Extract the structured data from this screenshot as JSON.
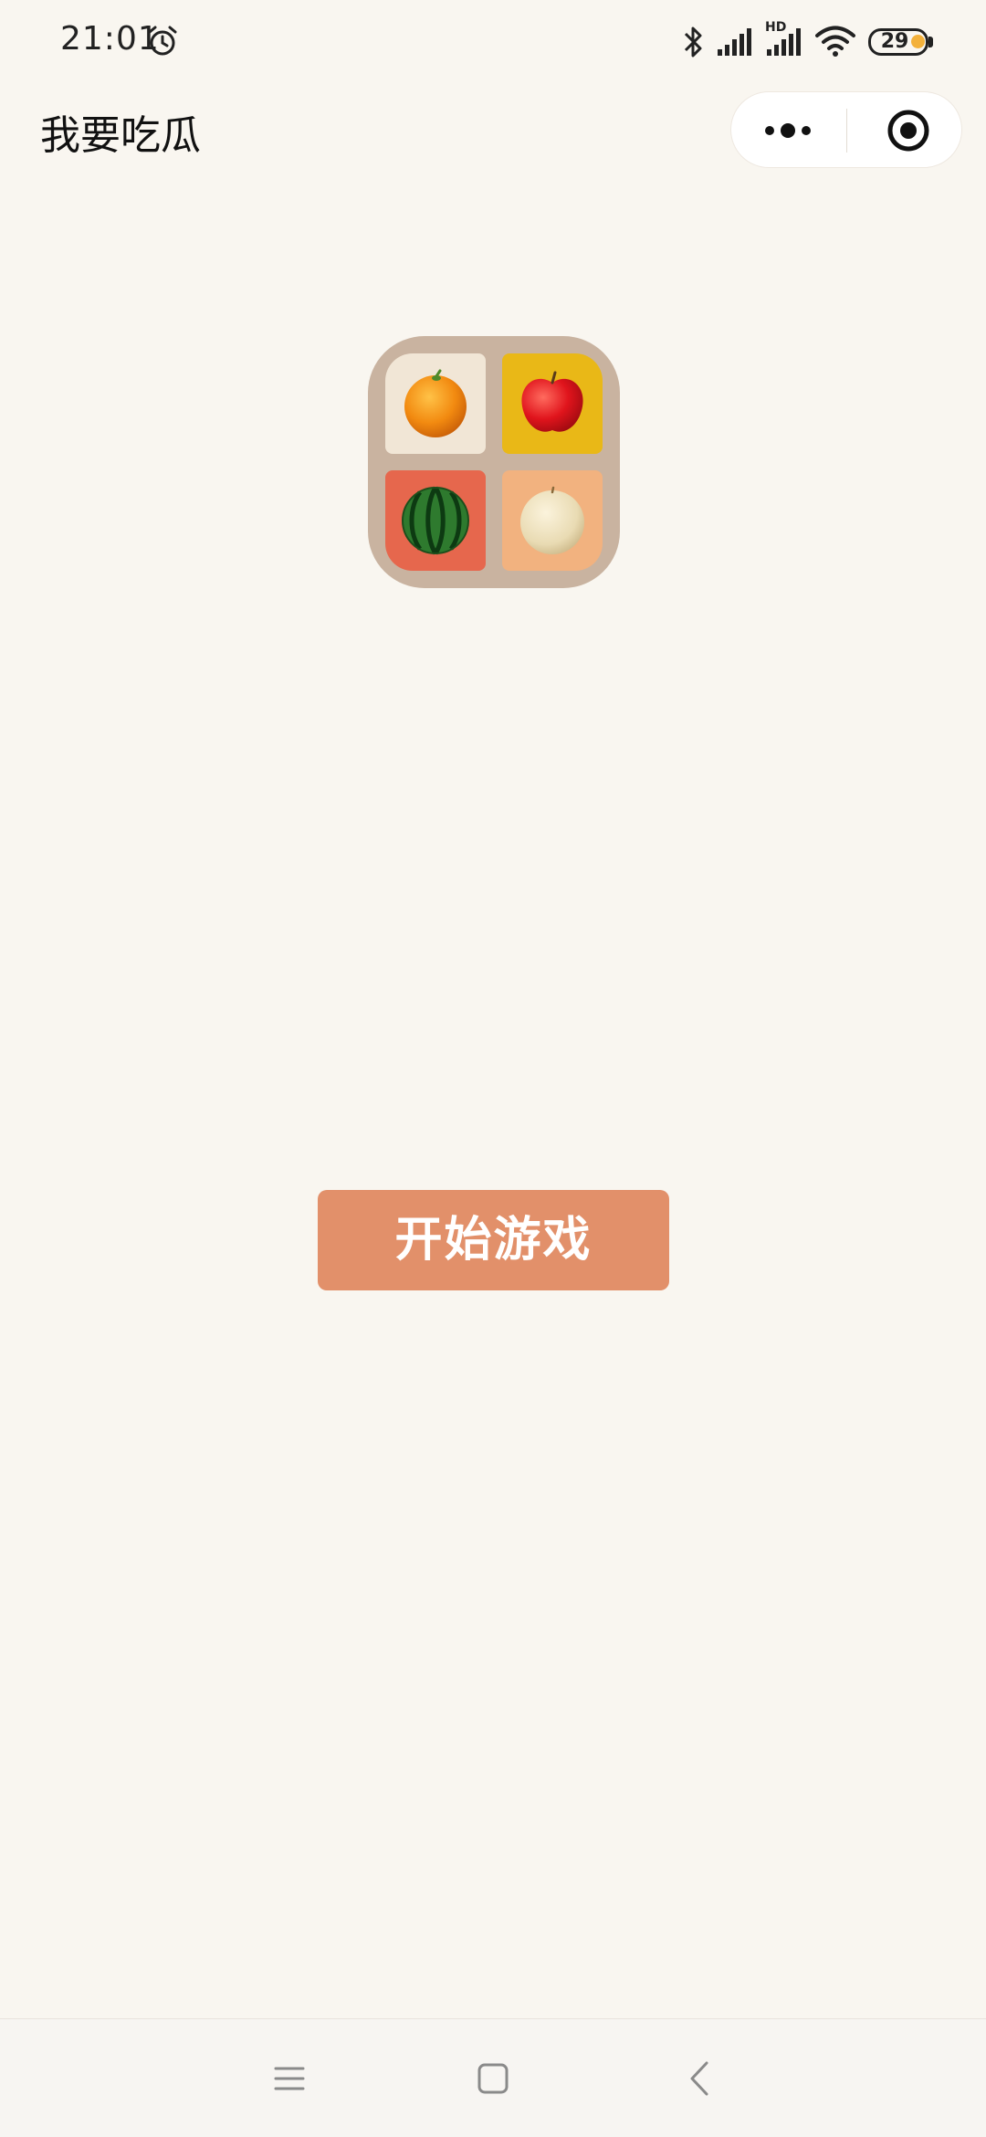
{
  "status_bar": {
    "time": "21:01",
    "battery_level": "29",
    "signal_badge": "HD",
    "icons": [
      "alarm-icon",
      "bluetooth-icon",
      "signal-icon",
      "signal-hd-icon",
      "wifi-icon",
      "battery-icon"
    ]
  },
  "header": {
    "title": "我要吃瓜",
    "capsule_icons": [
      "more-dots-icon",
      "close-target-icon"
    ]
  },
  "logo": {
    "fruits": [
      "orange-icon",
      "apple-icon",
      "watermelon-icon",
      "pear-icon"
    ],
    "tile_colors": [
      "#f1e6d6",
      "#e9b817",
      "#e6674d",
      "#f2b27f"
    ]
  },
  "main": {
    "start_button_label": "开始游戏"
  },
  "colors": {
    "background": "#f9f6f0",
    "accent": "#e2906a"
  },
  "nav": {
    "icons": [
      "menu-icon",
      "home-square-icon",
      "back-chevron-icon"
    ]
  }
}
